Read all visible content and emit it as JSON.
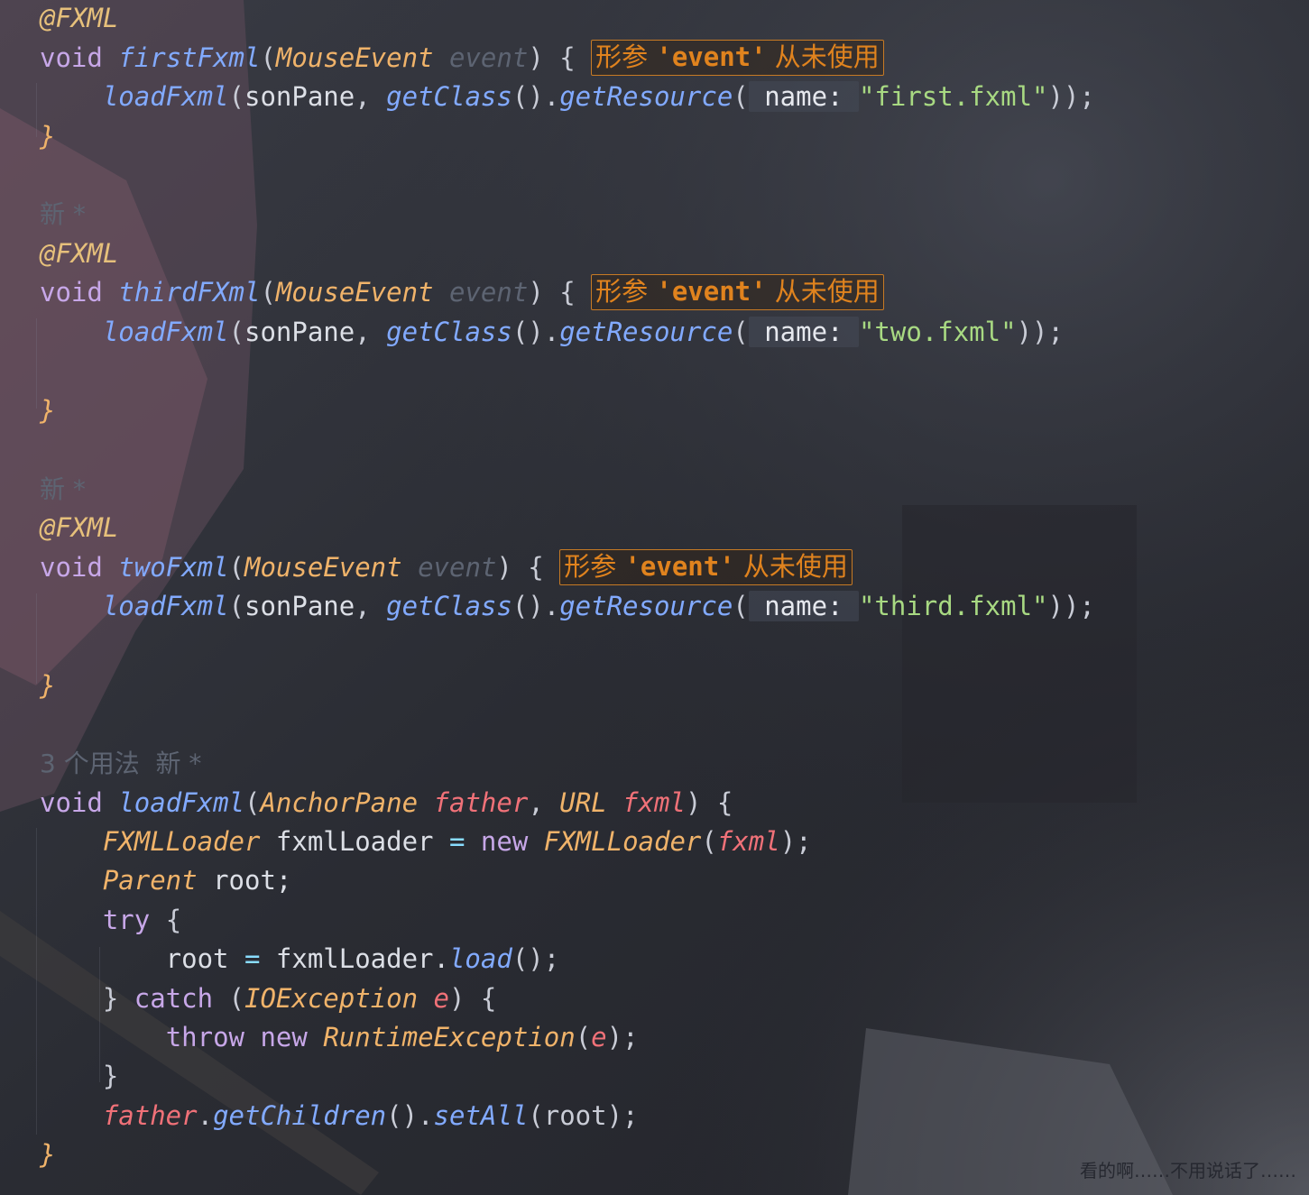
{
  "editor": {
    "background_color": "#2b2d34",
    "lines": [
      {
        "y": 0,
        "tokens": [
          {
            "t": "@FXML",
            "c": "ann"
          }
        ]
      },
      {
        "y": 0,
        "tokens": [
          {
            "t": "void ",
            "c": "kw"
          },
          {
            "t": "firstFxml",
            "c": "fn"
          },
          {
            "t": "(",
            "c": "punct"
          },
          {
            "t": "MouseEvent",
            "c": "type"
          },
          {
            "t": " ",
            "c": "plain"
          },
          {
            "t": "event",
            "c": "unused"
          },
          {
            "t": ") { ",
            "c": "punct"
          },
          {
            "warn": true
          }
        ]
      },
      {
        "y": 0,
        "tokens": [
          {
            "t": "    ",
            "c": "plain"
          },
          {
            "t": "loadFxml",
            "c": "fn"
          },
          {
            "t": "(",
            "c": "punct"
          },
          {
            "t": "sonPane",
            "c": "plain"
          },
          {
            "t": ", ",
            "c": "punct"
          },
          {
            "t": "getClass",
            "c": "fn"
          },
          {
            "t": "().",
            "c": "punct"
          },
          {
            "t": "getResource",
            "c": "fn"
          },
          {
            "t": "(",
            "c": "punct"
          },
          {
            "t": " name: ",
            "c": "ph"
          },
          {
            "t": "\"first.fxml\"",
            "c": "str"
          },
          {
            "t": "));",
            "c": "punct"
          }
        ]
      },
      {
        "y": 0,
        "tokens": [
          {
            "t": "}",
            "c": "type"
          }
        ]
      },
      {
        "y": 0,
        "tokens": []
      },
      {
        "y": 0,
        "tokens": [
          {
            "t": "新 *",
            "c": "gray"
          }
        ]
      },
      {
        "y": 0,
        "tokens": [
          {
            "t": "@FXML",
            "c": "ann"
          }
        ]
      },
      {
        "y": 0,
        "tokens": [
          {
            "t": "void ",
            "c": "kw"
          },
          {
            "t": "thirdFXml",
            "c": "fn"
          },
          {
            "t": "(",
            "c": "punct"
          },
          {
            "t": "MouseEvent",
            "c": "type"
          },
          {
            "t": " ",
            "c": "plain"
          },
          {
            "t": "event",
            "c": "unused"
          },
          {
            "t": ") { ",
            "c": "punct"
          },
          {
            "warn": true
          }
        ]
      },
      {
        "y": 0,
        "tokens": [
          {
            "t": "    ",
            "c": "plain"
          },
          {
            "t": "loadFxml",
            "c": "fn"
          },
          {
            "t": "(",
            "c": "punct"
          },
          {
            "t": "sonPane",
            "c": "plain"
          },
          {
            "t": ", ",
            "c": "punct"
          },
          {
            "t": "getClass",
            "c": "fn"
          },
          {
            "t": "().",
            "c": "punct"
          },
          {
            "t": "getResource",
            "c": "fn"
          },
          {
            "t": "(",
            "c": "punct"
          },
          {
            "t": " name: ",
            "c": "ph"
          },
          {
            "t": "\"two.fxml\"",
            "c": "str"
          },
          {
            "t": "));",
            "c": "punct"
          }
        ]
      },
      {
        "y": 0,
        "tokens": []
      },
      {
        "y": 0,
        "tokens": [
          {
            "t": "}",
            "c": "type"
          }
        ]
      },
      {
        "y": 0,
        "tokens": []
      },
      {
        "y": 0,
        "tokens": [
          {
            "t": "新 *",
            "c": "gray"
          }
        ]
      },
      {
        "y": 0,
        "tokens": [
          {
            "t": "@FXML",
            "c": "ann"
          }
        ]
      },
      {
        "y": 0,
        "tokens": [
          {
            "t": "void ",
            "c": "kw"
          },
          {
            "t": "twoFxml",
            "c": "fn"
          },
          {
            "t": "(",
            "c": "punct"
          },
          {
            "t": "MouseEvent",
            "c": "type"
          },
          {
            "t": " ",
            "c": "plain"
          },
          {
            "t": "event",
            "c": "unused"
          },
          {
            "t": ") { ",
            "c": "punct"
          },
          {
            "warn": true
          }
        ]
      },
      {
        "y": 0,
        "tokens": [
          {
            "t": "    ",
            "c": "plain"
          },
          {
            "t": "loadFxml",
            "c": "fn"
          },
          {
            "t": "(",
            "c": "punct"
          },
          {
            "t": "sonPane",
            "c": "plain"
          },
          {
            "t": ", ",
            "c": "punct"
          },
          {
            "t": "getClass",
            "c": "fn"
          },
          {
            "t": "().",
            "c": "punct"
          },
          {
            "t": "getResource",
            "c": "fn"
          },
          {
            "t": "(",
            "c": "punct"
          },
          {
            "t": " name: ",
            "c": "ph"
          },
          {
            "t": "\"third.fxml\"",
            "c": "str"
          },
          {
            "t": "));",
            "c": "punct"
          }
        ]
      },
      {
        "y": 0,
        "tokens": []
      },
      {
        "y": 0,
        "tokens": [
          {
            "t": "}",
            "c": "type"
          }
        ]
      },
      {
        "y": 0,
        "tokens": []
      },
      {
        "y": 0,
        "tokens": [
          {
            "t": "3 个用法  新 *",
            "c": "gray"
          }
        ]
      },
      {
        "y": 0,
        "tokens": [
          {
            "t": "void ",
            "c": "kw"
          },
          {
            "t": "loadFxml",
            "c": "fn"
          },
          {
            "t": "(",
            "c": "punct"
          },
          {
            "t": "AnchorPane",
            "c": "type"
          },
          {
            "t": " ",
            "c": "plain"
          },
          {
            "t": "father",
            "c": "param"
          },
          {
            "t": ", ",
            "c": "punct"
          },
          {
            "t": "URL",
            "c": "type"
          },
          {
            "t": " ",
            "c": "plain"
          },
          {
            "t": "fxml",
            "c": "param"
          },
          {
            "t": ") {",
            "c": "punct"
          }
        ]
      },
      {
        "y": 0,
        "tokens": [
          {
            "t": "    ",
            "c": "plain"
          },
          {
            "t": "FXMLLoader",
            "c": "type"
          },
          {
            "t": " fxmlLoader ",
            "c": "plain"
          },
          {
            "t": "=",
            "c": "op"
          },
          {
            "t": " ",
            "c": "plain"
          },
          {
            "t": "new",
            "c": "kw"
          },
          {
            "t": " ",
            "c": "plain"
          },
          {
            "t": "FXMLLoader",
            "c": "type"
          },
          {
            "t": "(",
            "c": "punct"
          },
          {
            "t": "fxml",
            "c": "param"
          },
          {
            "t": ");",
            "c": "punct"
          }
        ]
      },
      {
        "y": 0,
        "tokens": [
          {
            "t": "    ",
            "c": "plain"
          },
          {
            "t": "Parent",
            "c": "type"
          },
          {
            "t": " root;",
            "c": "plain"
          }
        ]
      },
      {
        "y": 0,
        "tokens": [
          {
            "t": "    ",
            "c": "plain"
          },
          {
            "t": "try",
            "c": "kw"
          },
          {
            "t": " {",
            "c": "punct"
          }
        ]
      },
      {
        "y": 0,
        "tokens": [
          {
            "t": "        root ",
            "c": "plain"
          },
          {
            "t": "=",
            "c": "op"
          },
          {
            "t": " fxmlLoader.",
            "c": "plain"
          },
          {
            "t": "load",
            "c": "fn"
          },
          {
            "t": "();",
            "c": "punct"
          }
        ]
      },
      {
        "y": 0,
        "tokens": [
          {
            "t": "    } ",
            "c": "punct"
          },
          {
            "t": "catch",
            "c": "kw"
          },
          {
            "t": " (",
            "c": "punct"
          },
          {
            "t": "IOException",
            "c": "type"
          },
          {
            "t": " ",
            "c": "plain"
          },
          {
            "t": "e",
            "c": "param"
          },
          {
            "t": ") {",
            "c": "punct"
          }
        ]
      },
      {
        "y": 0,
        "tokens": [
          {
            "t": "        ",
            "c": "plain"
          },
          {
            "t": "throw",
            "c": "kw"
          },
          {
            "t": " ",
            "c": "plain"
          },
          {
            "t": "new",
            "c": "kw"
          },
          {
            "t": " ",
            "c": "plain"
          },
          {
            "t": "RuntimeException",
            "c": "type"
          },
          {
            "t": "(",
            "c": "punct"
          },
          {
            "t": "e",
            "c": "param"
          },
          {
            "t": ");",
            "c": "punct"
          }
        ]
      },
      {
        "y": 0,
        "tokens": [
          {
            "t": "    }",
            "c": "punct"
          }
        ]
      },
      {
        "y": 0,
        "tokens": [
          {
            "t": "    ",
            "c": "plain"
          },
          {
            "t": "father",
            "c": "param"
          },
          {
            "t": ".",
            "c": "punct"
          },
          {
            "t": "getChildren",
            "c": "fn"
          },
          {
            "t": "().",
            "c": "punct"
          },
          {
            "t": "setAll",
            "c": "fn"
          },
          {
            "t": "(root);",
            "c": "punct"
          }
        ]
      },
      {
        "y": 0,
        "tokens": [
          {
            "t": "}",
            "c": "type"
          }
        ]
      }
    ]
  },
  "inspection": {
    "prefix": "形参 ",
    "name": "'event'",
    "suffix": " 从未使用"
  },
  "footer_text": "看的啊……不用说话了……"
}
